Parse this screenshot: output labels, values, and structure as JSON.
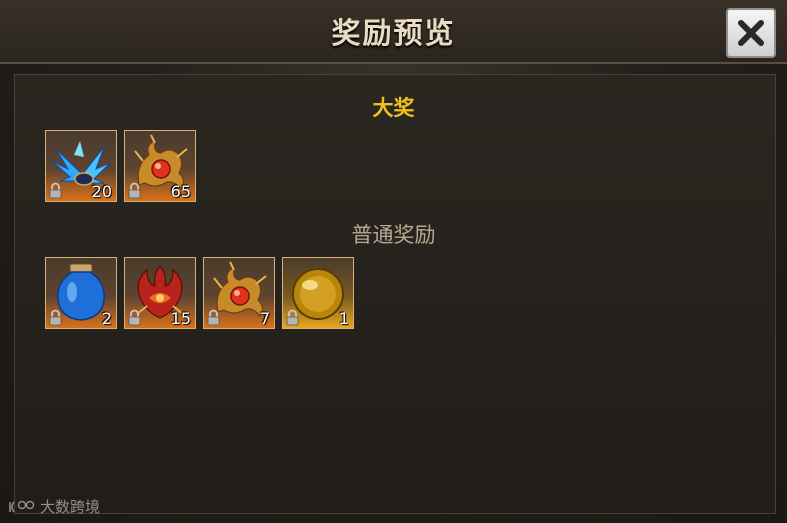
{
  "header": {
    "title": "奖励预览"
  },
  "close_button": {
    "icon": "close-icon"
  },
  "grand_prize": {
    "title": "大奖",
    "items": [
      {
        "name": "blue-wings-item",
        "qty": "20",
        "locked": true
      },
      {
        "name": "golden-orb-dragon-item",
        "qty": "65",
        "locked": true
      }
    ]
  },
  "normal_rewards": {
    "title": "普通奖励",
    "items": [
      {
        "name": "blue-jar-item",
        "qty": "2",
        "locked": true
      },
      {
        "name": "red-flame-dragon-item",
        "qty": "15",
        "locked": true
      },
      {
        "name": "golden-orb-dragon-item",
        "qty": "7",
        "locked": true
      },
      {
        "name": "amber-sphere-item",
        "qty": "1",
        "locked": true
      }
    ]
  },
  "watermark": {
    "text": "大数跨境"
  },
  "colors": {
    "grand_title": "#f1c01e",
    "normal_title": "#b8a992",
    "title": "#eadcc2"
  }
}
